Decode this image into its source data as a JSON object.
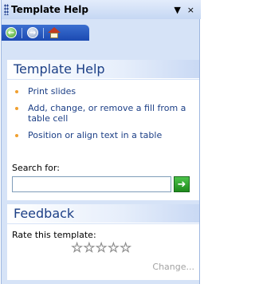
{
  "titlebar": {
    "title": "Template Help",
    "dropdown_glyph": "▼",
    "close_glyph": "×"
  },
  "navbar": {
    "back_icon": "back-arrow-icon",
    "forward_icon": "forward-arrow-icon",
    "home_icon": "home-icon"
  },
  "help_section": {
    "heading": "Template Help",
    "items": [
      {
        "text": "Print slides"
      },
      {
        "text": "Add, change, or remove a fill from a table cell"
      },
      {
        "text": "Position or align text in a table"
      }
    ],
    "search_label": "Search for:",
    "search_value": "",
    "go_icon": "go-arrow-icon"
  },
  "feedback_section": {
    "heading": "Feedback",
    "rate_label": "Rate this template:",
    "rating": {
      "value": 0,
      "max": 5
    },
    "change_link": "Change..."
  },
  "colors": {
    "heading_text": "#1c3f86",
    "bullet": "#f0a030",
    "pane_background": "#d6e3f7",
    "nav_blue": "#1c4ab2"
  }
}
